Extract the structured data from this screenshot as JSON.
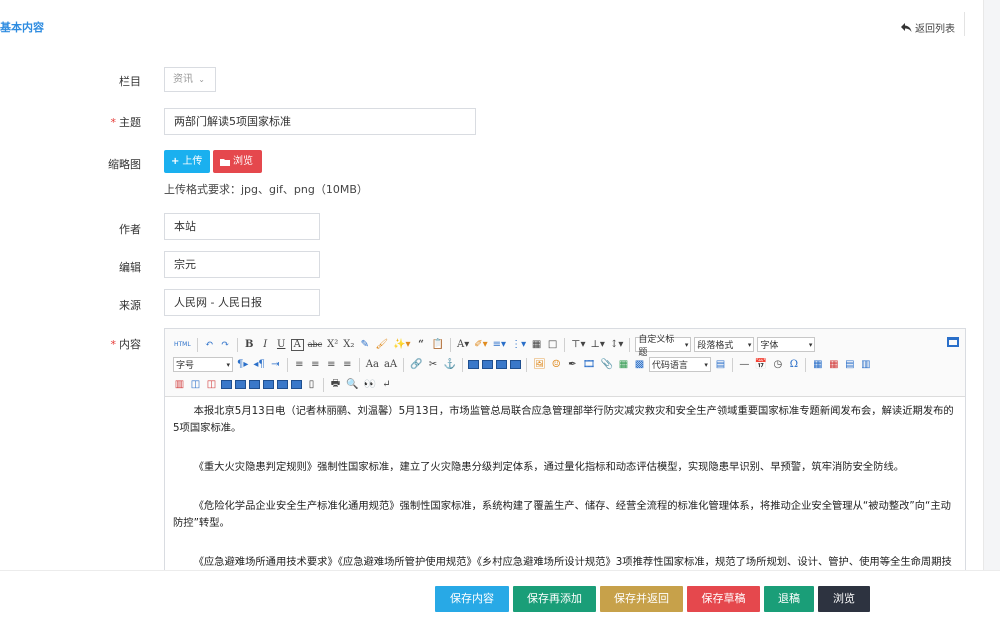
{
  "header": {
    "section_title": "基本内容",
    "back_label": "返回列表"
  },
  "form": {
    "column": {
      "label": "栏目",
      "value": "资讯"
    },
    "subject": {
      "label": "主题",
      "value": "两部门解读5项国家标准"
    },
    "thumbnail": {
      "label": "缩略图",
      "upload_label": "上传",
      "browse_label": "浏览",
      "hint": "上传格式要求：jpg、gif、png（10MB）"
    },
    "author": {
      "label": "作者",
      "value": "本站"
    },
    "editor": {
      "label": "编辑",
      "value": "宗元"
    },
    "source": {
      "label": "来源",
      "value": "人民网 - 人民日报"
    },
    "content": {
      "label": "内容"
    }
  },
  "toolbar": {
    "html_label": "HTML",
    "custom_title": "自定义标题",
    "paragraph_format": "段落格式",
    "font_family": "字体",
    "font_size": "字号",
    "code_language": "代码语言"
  },
  "content": {
    "paragraphs": [
      "本报北京5月13日电（记者林丽鹂、刘温馨）5月13日，市场监管总局联合应急管理部举行防灾减灾救灾和安全生产领域重要国家标准专题新闻发布会，解读近期发布的5项国家标准。",
      "《重大火灾隐患判定规则》强制性国家标准，建立了火灾隐患分级判定体系，通过量化指标和动态评估模型，实现隐患早识别、早预警，筑牢消防安全防线。",
      "《危险化学品企业安全生产标准化通用规范》强制性国家标准，系统构建了覆盖生产、储存、经营全流程的标准化管理体系，将推动企业安全管理从“被动整改”向“主动防控”转型。",
      "《应急避难场所通用技术要求》《应急避难场所管护使用规范》《乡村应急避难场所设计规范》3项推荐性国家标准，规范了场所规划、设计、管护、使用等全生命周期技术要求，将有效提升社会应急避难能力水平，确保灾害发生时人民群众能够“有地可避、有序可循”。"
    ]
  },
  "footer": {
    "save": "保存内容",
    "save_add": "保存再添加",
    "save_return": "保存并返回",
    "save_draft": "保存草稿",
    "reject": "退稿",
    "preview": "浏览"
  },
  "colors": {
    "accent": "#2e8ce0",
    "upload_btn": "#1ab0ef",
    "browse_btn": "#e5484d",
    "save": "#28a9e6",
    "save_add": "#1a9e78",
    "save_return": "#c7a14a",
    "save_draft": "#e5484d",
    "reject": "#1a9e78",
    "preview": "#2d3340"
  }
}
